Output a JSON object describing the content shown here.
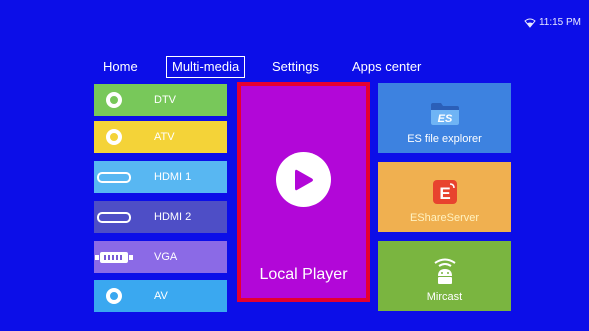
{
  "status": {
    "time": "11:15 PM",
    "icon": "wifi-icon"
  },
  "nav": {
    "tabs": [
      "Home",
      "Multi-media",
      "Settings",
      "Apps center"
    ],
    "active": "Multi-media"
  },
  "sources": [
    {
      "label": "DTV",
      "icon": "ring-icon",
      "color": "#78c85a"
    },
    {
      "label": "ATV",
      "icon": "ring-icon",
      "color": "#f4d338"
    },
    {
      "label": "HDMI 1",
      "icon": "tv-icon",
      "color": "#58b7f2"
    },
    {
      "label": "HDMI 2",
      "icon": "tv-icon",
      "color": "#4e4ec6"
    },
    {
      "label": "VGA",
      "icon": "vga-icon",
      "color": "#8b6ae6"
    },
    {
      "label": "AV",
      "icon": "ring-icon",
      "color": "#3aa8f0"
    }
  ],
  "feature": {
    "label": "Local Player",
    "icon": "play-icon",
    "color": "#b207d8",
    "border": "#e50030"
  },
  "apps": [
    {
      "label": "ES file explorer",
      "icon": "es-folder-icon",
      "color": "#3d82e0"
    },
    {
      "label": "EShareServer",
      "icon": "eshare-icon",
      "color": "#f0b050"
    },
    {
      "label": "Mircast",
      "icon": "android-cast-icon",
      "color": "#7ab540"
    }
  ]
}
